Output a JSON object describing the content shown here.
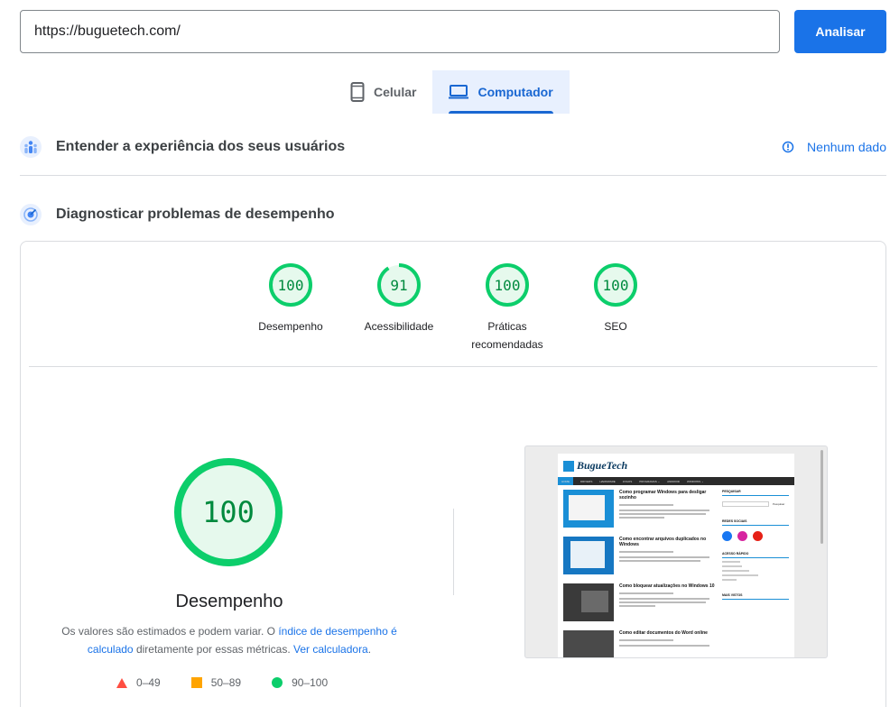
{
  "url_bar": {
    "value": "https://buguetech.com/",
    "analyze_label": "Analisar",
    "accent": "#1a73e8"
  },
  "tabs": [
    {
      "label": "Celular",
      "icon": "smartphone-icon",
      "active": false
    },
    {
      "label": "Computador",
      "icon": "laptop-icon",
      "active": true
    }
  ],
  "field_data": {
    "title": "Entender a experiência dos seus usuários",
    "status": "Nenhum dado",
    "status_icon": "info-icon"
  },
  "lab_data": {
    "title": "Diagnosticar problemas de desempenho"
  },
  "scores": [
    {
      "value": "100",
      "label": "Desempenho",
      "score": 100
    },
    {
      "value": "91",
      "label": "Acessibilidade",
      "score": 91
    },
    {
      "value": "100",
      "label": "Práticas recomendadas",
      "score": 100
    },
    {
      "value": "100",
      "label": "SEO",
      "score": 100
    }
  ],
  "performance": {
    "score": "100",
    "title": "Desempenho",
    "note_before": "Os valores são estimados e podem variar. O ",
    "note_link1": "índice de desempenho é calculado",
    "note_middle": " diretamente por essas métricas. ",
    "note_link2": "Ver calculadora",
    "note_end": "."
  },
  "legend": [
    {
      "range": "0–49",
      "color": "#ff4e42",
      "shape": "triangle"
    },
    {
      "range": "50–89",
      "color": "#ffa400",
      "shape": "square"
    },
    {
      "range": "90–100",
      "color": "#0cce6b",
      "shape": "circle"
    }
  ],
  "colors": {
    "pass": "#0cce6b",
    "pass_text": "#008a3e",
    "pass_bg": "#e6f9ed"
  },
  "preview": {
    "logo": "BugueTech",
    "nav": [
      "HOME",
      "DRIVERS",
      "HARDWARE",
      "JOGOS",
      "PROGRAMAS ⌄",
      "ANDROID",
      "WINDOWS ⌄"
    ],
    "posts": [
      "Como programar Windows para desligar sozinho",
      "Como encontrar arquivos duplicados no Windows",
      "Como bloquear atualizações no Windows 10",
      "Como editar documentos do Word online"
    ],
    "sidebar": [
      "PESQUISAR",
      "REDES SOCIAIS",
      "ACESSO RÁPIDO",
      "MAIS VISTOS"
    ],
    "search_button": "Pesquisar"
  }
}
